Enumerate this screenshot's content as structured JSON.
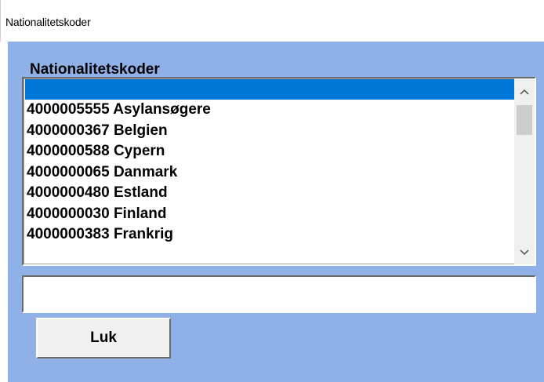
{
  "window": {
    "title": "Nationalitetskoder"
  },
  "group": {
    "label": "Nationalitetskoder"
  },
  "list": {
    "selected_index": 0,
    "items": [
      "",
      "4000005555 Asylansøgere",
      "4000000367 Belgien",
      "4000000588 Cypern",
      "4000000065 Danmark",
      "4000000480 Estland",
      "4000000030 Finland",
      "4000000383 Frankrig"
    ]
  },
  "scrollbar": {
    "up_icon": "chevron-up",
    "down_icon": "chevron-down"
  },
  "input": {
    "value": "",
    "placeholder": ""
  },
  "buttons": {
    "close_label": "Luk"
  },
  "colors": {
    "client_background": "#8fb1e8",
    "selection": "#0078d7"
  }
}
